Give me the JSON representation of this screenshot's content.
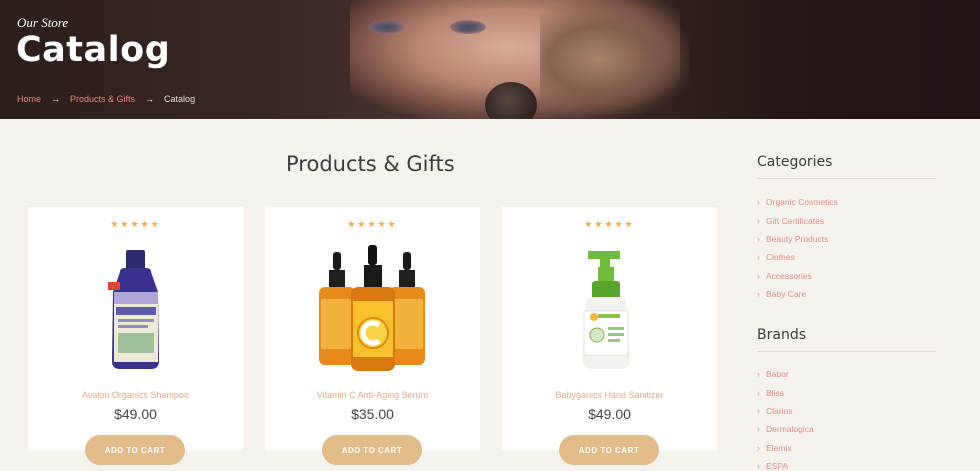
{
  "hero": {
    "subtitle": "Our Store",
    "title": "Catalog",
    "breadcrumb": {
      "home": "Home",
      "separator": "→",
      "parent": "Products & Gifts",
      "current": "Catalog"
    }
  },
  "main": {
    "section_title": "Products & Gifts",
    "products": [
      {
        "name": "Avalon Organics Shampoo",
        "price": "$49.00",
        "rating": 5,
        "stars": "★★★★★",
        "button": "ADD TO CART"
      },
      {
        "name": "Vitamin C Anti-Aging Serum",
        "price": "$35.00",
        "rating": 5,
        "stars": "★★★★★",
        "button": "ADD TO CART"
      },
      {
        "name": "Babyganics Hand Sanitizer",
        "price": "$49.00",
        "rating": 5,
        "stars": "★★★★★",
        "button": "ADD TO CART"
      }
    ]
  },
  "sidebar": {
    "categories_title": "Categories",
    "categories": [
      "Organic Cosmetics",
      "Gift Certificates",
      "Beauty Products",
      "Clothes",
      "Accessories",
      "Baby Care"
    ],
    "brands_title": "Brands",
    "brands": [
      "Babor",
      "Bliss",
      "Clarins",
      "Dermalogica",
      "Elemis",
      "ESPA"
    ],
    "chevron": "›"
  },
  "colors": {
    "accent": "#e2bb8a",
    "link": "#e08d82",
    "stars": "#f4a742",
    "background": "#f6f2ee"
  },
  "icons": {
    "list_marker": "chevron-right-icon",
    "rating": "star-icon"
  }
}
